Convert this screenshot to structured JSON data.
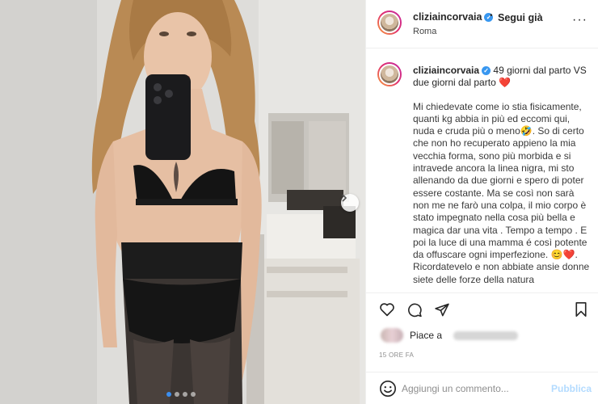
{
  "post": {
    "username": "cliziaincorvaia",
    "verified_badge": "✓",
    "follow_separator": "•",
    "follow_label": "Segui già",
    "location": "Roma",
    "more_label": "···"
  },
  "caption": {
    "username": "cliziaincorvaia",
    "title": "49 giorni dal parto VS due giorni dal parto",
    "title_emoji": "❤️",
    "body_lines": [
      "Mi chiedevate come io stia fisicamente,",
      "quanti kg abbia in più ed eccomi qui,",
      "nuda e cruda più o meno🤣. So di certo",
      "che non ho recuperato appieno la mia",
      "vecchia forma, sono più morbida e si",
      "intravede ancora la linea nigra, mi sto",
      "allenando da due giorni e spero di poter",
      "essere costante. Ma se così non sarà non",
      "me ne farò una colpa, il mio corpo è",
      "stato impegnato nella cosa più bella e",
      "magica dar una vita . Tempo a tempo .",
      "E poi la luce di una mamma é così",
      "potente da offuscare ogni imperfezione.",
      "😊❤️. Ricordatevelo e non abbiate",
      "ansie donne siete delle forze della natura"
    ]
  },
  "actions": {
    "like_icon": "heart-outline-icon",
    "comment_icon": "comment-bubble-icon",
    "share_icon": "paper-plane-icon",
    "save_icon": "bookmark-icon"
  },
  "likes": {
    "prefix": "Piace a"
  },
  "timestamp": "15 ORE FA",
  "comment_box": {
    "placeholder": "Aggiungi un commento...",
    "publish_label": "Pubblica",
    "emoji_icon": "smiley-icon"
  },
  "carousel": {
    "slide_count": 4,
    "active_index": 0,
    "next_icon": "chevron-right-icon"
  },
  "colors": {
    "accent_blue": "#3897f0",
    "publish_disabled": "#b3dbff",
    "heart_red": "#e0245e"
  }
}
